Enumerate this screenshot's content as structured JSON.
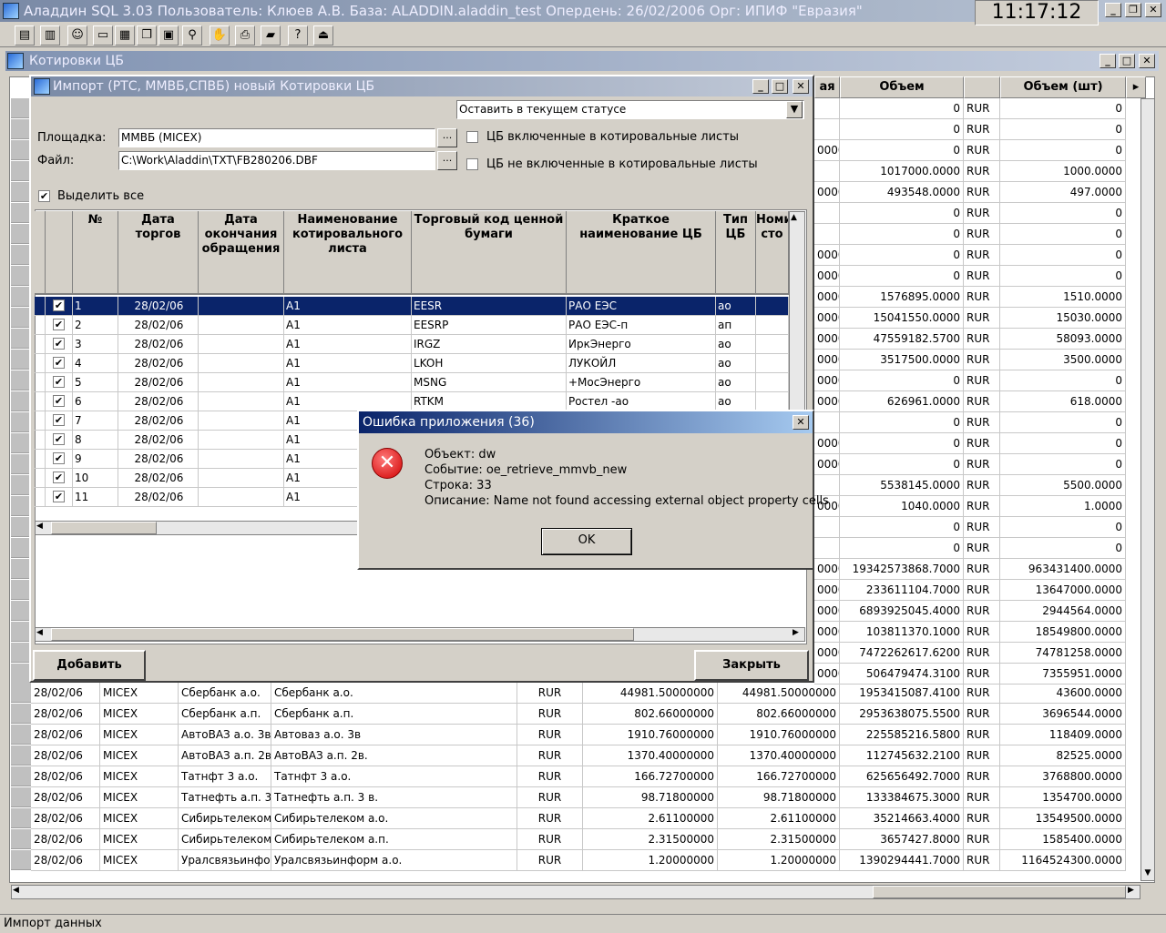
{
  "app": {
    "title": "Аладдин SQL 3.03 Пользователь: Клюев А.В. База: ALADDIN.aladdin_test Опердень: 26/02/2006 Орг: ИПИФ \"Евразия\"",
    "clock": "11:17:12"
  },
  "mdi": {
    "title": "Котировки ЦБ"
  },
  "bg_grid": {
    "headers": [
      "ая",
      "Объем",
      "Объем (шт)"
    ],
    "right_rows": [
      [
        "",
        "0",
        "RUR",
        "0"
      ],
      [
        "",
        "0",
        "RUR",
        "0"
      ],
      [
        "0000",
        "0",
        "RUR",
        "0"
      ],
      [
        "",
        "1017000.0000",
        "RUR",
        "1000.0000"
      ],
      [
        "0000",
        "493548.0000",
        "RUR",
        "497.0000"
      ],
      [
        "",
        "0",
        "RUR",
        "0"
      ],
      [
        "",
        "0",
        "RUR",
        "0"
      ],
      [
        "0000",
        "0",
        "RUR",
        "0"
      ],
      [
        "0000",
        "0",
        "RUR",
        "0"
      ],
      [
        "0000",
        "1576895.0000",
        "RUR",
        "1510.0000"
      ],
      [
        "0000",
        "15041550.0000",
        "RUR",
        "15030.0000"
      ],
      [
        "0000",
        "47559182.5700",
        "RUR",
        "58093.0000"
      ],
      [
        "0000",
        "3517500.0000",
        "RUR",
        "3500.0000"
      ],
      [
        "0000",
        "0",
        "RUR",
        "0"
      ],
      [
        "0000",
        "626961.0000",
        "RUR",
        "618.0000"
      ],
      [
        "",
        "0",
        "RUR",
        "0"
      ],
      [
        "0000",
        "0",
        "RUR",
        "0"
      ],
      [
        "0000",
        "0",
        "RUR",
        "0"
      ],
      [
        "",
        "5538145.0000",
        "RUR",
        "5500.0000"
      ],
      [
        "0000",
        "1040.0000",
        "RUR",
        "1.0000"
      ],
      [
        "",
        "0",
        "RUR",
        "0"
      ],
      [
        "",
        "0",
        "RUR",
        "0"
      ],
      [
        "0000",
        "19342573868.7000",
        "RUR",
        "963431400.0000"
      ],
      [
        "0000",
        "233611104.7000",
        "RUR",
        "13647000.0000"
      ],
      [
        "0000",
        "6893925045.4000",
        "RUR",
        "2944564.0000"
      ],
      [
        "0000",
        "103811370.1000",
        "RUR",
        "18549800.0000"
      ],
      [
        "0000",
        "7472262617.6200",
        "RUR",
        "74781258.0000"
      ],
      [
        "0000",
        "506479474.3100",
        "RUR",
        "7355951.0000"
      ]
    ],
    "full_rows": [
      [
        "28/02/06",
        "MICEX",
        "Сбербанк а.о.",
        "Сбербанк а.о.",
        "RUR",
        "44981.50000000",
        "44981.50000000",
        "1953415087.4100",
        "RUR",
        "43600.0000"
      ],
      [
        "28/02/06",
        "MICEX",
        "Сбербанк а.п.",
        "Сбербанк а.п.",
        "RUR",
        "802.66000000",
        "802.66000000",
        "2953638075.5500",
        "RUR",
        "3696544.0000"
      ],
      [
        "28/02/06",
        "MICEX",
        "АвтоВАЗ а.о. 3в",
        "Автоваз а.о. 3в",
        "RUR",
        "1910.76000000",
        "1910.76000000",
        "225585216.5800",
        "RUR",
        "118409.0000"
      ],
      [
        "28/02/06",
        "MICEX",
        "АвтоВАЗ а.п. 2в",
        "АвтоВАЗ а.п. 2в.",
        "RUR",
        "1370.40000000",
        "1370.40000000",
        "112745632.2100",
        "RUR",
        "82525.0000"
      ],
      [
        "28/02/06",
        "MICEX",
        "Татнфт 3 а.о.",
        "Татнфт 3 а.о.",
        "RUR",
        "166.72700000",
        "166.72700000",
        "625656492.7000",
        "RUR",
        "3768800.0000"
      ],
      [
        "28/02/06",
        "MICEX",
        "Татнефть а.п. 3 в",
        "Татнефть а.п. 3 в.",
        "RUR",
        "98.71800000",
        "98.71800000",
        "133384675.3000",
        "RUR",
        "1354700.0000"
      ],
      [
        "28/02/06",
        "MICEX",
        "Сибирьтелеком а.о.",
        "Сибирьтелеком а.о.",
        "RUR",
        "2.61100000",
        "2.61100000",
        "35214663.4000",
        "RUR",
        "13549500.0000"
      ],
      [
        "28/02/06",
        "MICEX",
        "Сибирьтелеком а.п.",
        "Сибирьтелеком а.п.",
        "RUR",
        "2.31500000",
        "2.31500000",
        "3657427.8000",
        "RUR",
        "1585400.0000"
      ],
      [
        "28/02/06",
        "MICEX",
        "Уралсвязьинформ а.о.",
        "Уралсвязьинформ а.о.",
        "RUR",
        "1.20000000",
        "1.20000000",
        "1390294441.7000",
        "RUR",
        "1164524300.0000"
      ]
    ]
  },
  "import_dialog": {
    "title": "Импорт (РТС, ММВБ,СПВБ) новый Котировки ЦБ",
    "status_select": "Оставить в текущем статусе",
    "platform_label": "Площадка:",
    "platform_value": "ММВБ (MICEX)",
    "file_label": "Файл:",
    "file_value": "C:\\Work\\Aladdin\\TXT\\FB280206.DBF",
    "chk_included": "ЦБ включенные в котировальные листы",
    "chk_not_included": "ЦБ не включенные в котировальные листы",
    "select_all": "Выделить все",
    "headers": [
      "№",
      "Дата торгов",
      "Дата окончания обращения",
      "Наименование котировального листа",
      "Торговый код ценной бумаги",
      "Краткое наименование ЦБ",
      "Тип ЦБ",
      "Номи сто"
    ],
    "rows": [
      [
        "1",
        "28/02/06",
        "",
        "A1",
        "EESR",
        "РАО ЕЭС",
        "ао"
      ],
      [
        "2",
        "28/02/06",
        "",
        "A1",
        "EESRP",
        "РАО ЕЭС-п",
        "ап"
      ],
      [
        "3",
        "28/02/06",
        "",
        "A1",
        "IRGZ",
        "ИркЭнерго",
        "ао"
      ],
      [
        "4",
        "28/02/06",
        "",
        "A1",
        "LKOH",
        "ЛУКОЙЛ",
        "ао"
      ],
      [
        "5",
        "28/02/06",
        "",
        "A1",
        "MSNG",
        "+МосЭнерго",
        "ао"
      ],
      [
        "6",
        "28/02/06",
        "",
        "A1",
        "RTKM",
        "Ростел -ао",
        "ао"
      ],
      [
        "7",
        "28/02/06",
        "",
        "A1",
        "",
        "",
        ""
      ],
      [
        "8",
        "28/02/06",
        "",
        "A1",
        "",
        "",
        ""
      ],
      [
        "9",
        "28/02/06",
        "",
        "A1",
        "",
        "",
        ""
      ],
      [
        "10",
        "28/02/06",
        "",
        "A1",
        "",
        "",
        ""
      ],
      [
        "11",
        "28/02/06",
        "",
        "A1",
        "",
        "",
        ""
      ]
    ],
    "add_button": "Добавить",
    "close_button": "Закрыть"
  },
  "error_dialog": {
    "title": "Ошибка приложения (36)",
    "lines": [
      "Объект: dw",
      "Событие: oe_retrieve_mmvb_new",
      "Строка: 33",
      "Описание: Name not found accessing external object property cells"
    ],
    "ok": "OK"
  },
  "status_bar": {
    "text": "Импорт данных"
  }
}
